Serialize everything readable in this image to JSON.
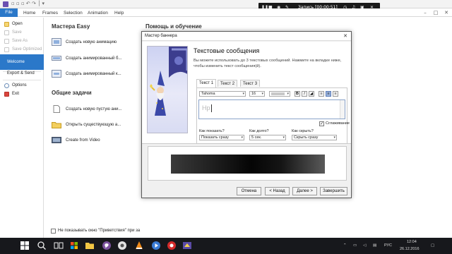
{
  "menubar": {
    "tabs": [
      "File",
      "Home",
      "Frames",
      "Selection",
      "Animation",
      "Help"
    ]
  },
  "recorder": {
    "title": "Запись [00:00:51]"
  },
  "sidebar": {
    "items": [
      "Open",
      "Save",
      "Save As",
      "Save Optimized",
      "Welcome",
      "Export & Send",
      "Options",
      "Exit"
    ]
  },
  "main": {
    "easy_title": "Мастера Easy",
    "help_title": "Помощь и обучение",
    "general_title": "Общие задачи",
    "tasks_easy": [
      "Создать новую анимацию",
      "Создать анимированный б...",
      "Создать анимированный к..."
    ],
    "tasks_general": [
      "Создать новую пустую ани...",
      "Открыть существующую а...",
      "Create from Video"
    ],
    "dont_show": "Не показывать окно \"Приветствия\" при за"
  },
  "dialog": {
    "title": "Мастер баннера",
    "heading": "Текстовые сообщения",
    "description": "Вы можете использовать до 3 текстовых сообщений. Нажмите на вкладке ниже, чтобы изменить текст сообщения(й).",
    "tabs": [
      "Текст 1",
      "Текст 2",
      "Текст 3"
    ],
    "font": "Tahoma",
    "size": "16",
    "text_placeholder": "Hp",
    "smooth_label": "Сглаживание",
    "show_label": "Как показать?",
    "show_value": "Показать сразу",
    "duration_label": "Как долго?",
    "duration_value": "5 сек.",
    "hide_label": "Как скрыть?",
    "hide_value": "Скрыть сразу",
    "buttons": {
      "cancel": "Отмена",
      "back": "< Назад",
      "next": "Далее >",
      "finish": "Завершить"
    }
  },
  "taskbar": {
    "language": "РУС",
    "time": "12:04",
    "date": "26.12.2016"
  },
  "colors": {
    "accent": "#2b78c9",
    "taskbar": "#17181c",
    "recorder": "#1a1a1a"
  }
}
